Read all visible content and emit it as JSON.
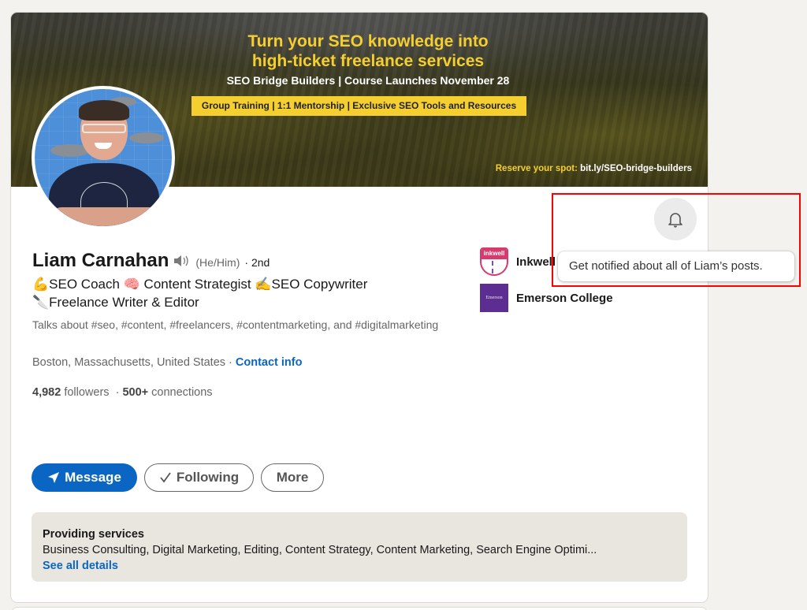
{
  "banner": {
    "title_line1": "Turn your SEO knowledge into",
    "title_line2": "high-ticket freelance services",
    "subtitle": "SEO Bridge Builders | Course Launches November 28",
    "tagline": "Group Training | 1:1 Mentorship | Exclusive SEO Tools and Resources",
    "reserve_label": "Reserve your spot:",
    "reserve_link": "bit.ly/SEO-bridge-builders"
  },
  "profile": {
    "name": "Liam Carnahan",
    "pronunciation_icon": "speaker-icon",
    "pronouns": "(He/Him)",
    "degree": "· 2nd",
    "headline_line1": "💪SEO Coach 🧠 Content Strategist ✍️SEO Copywriter",
    "headline_line2": "🔪Freelance Writer & Editor",
    "talks_about": "Talks about #seo, #content, #freelancers, #contentmarketing, and #digitalmarketing",
    "location": "Boston, Massachusetts, United States",
    "separator": " · ",
    "contact_info": "Contact info",
    "followers_count": "4,982",
    "followers_label": "followers",
    "connections_count": "500+",
    "connections_label": "connections"
  },
  "actions": {
    "message": "Message",
    "following": "Following",
    "more": "More"
  },
  "companies": [
    {
      "name": "Inkwell",
      "logo_text": "inkwell"
    },
    {
      "name": "Emerson College",
      "logo_text": "Emerson"
    }
  ],
  "notifications": {
    "bell_icon": "bell-icon",
    "tooltip": "Get notified about all of Liam’s posts."
  },
  "services": {
    "header": "Providing services",
    "list": "Business Consulting, Digital Marketing, Editing, Content Strategy, Content Marketing, Search Engine Optimi...",
    "link": "See all details"
  },
  "colors": {
    "brand_blue": "#0a66c2",
    "banner_yellow": "#f4cf2f",
    "highlight_red": "#ff0000"
  }
}
